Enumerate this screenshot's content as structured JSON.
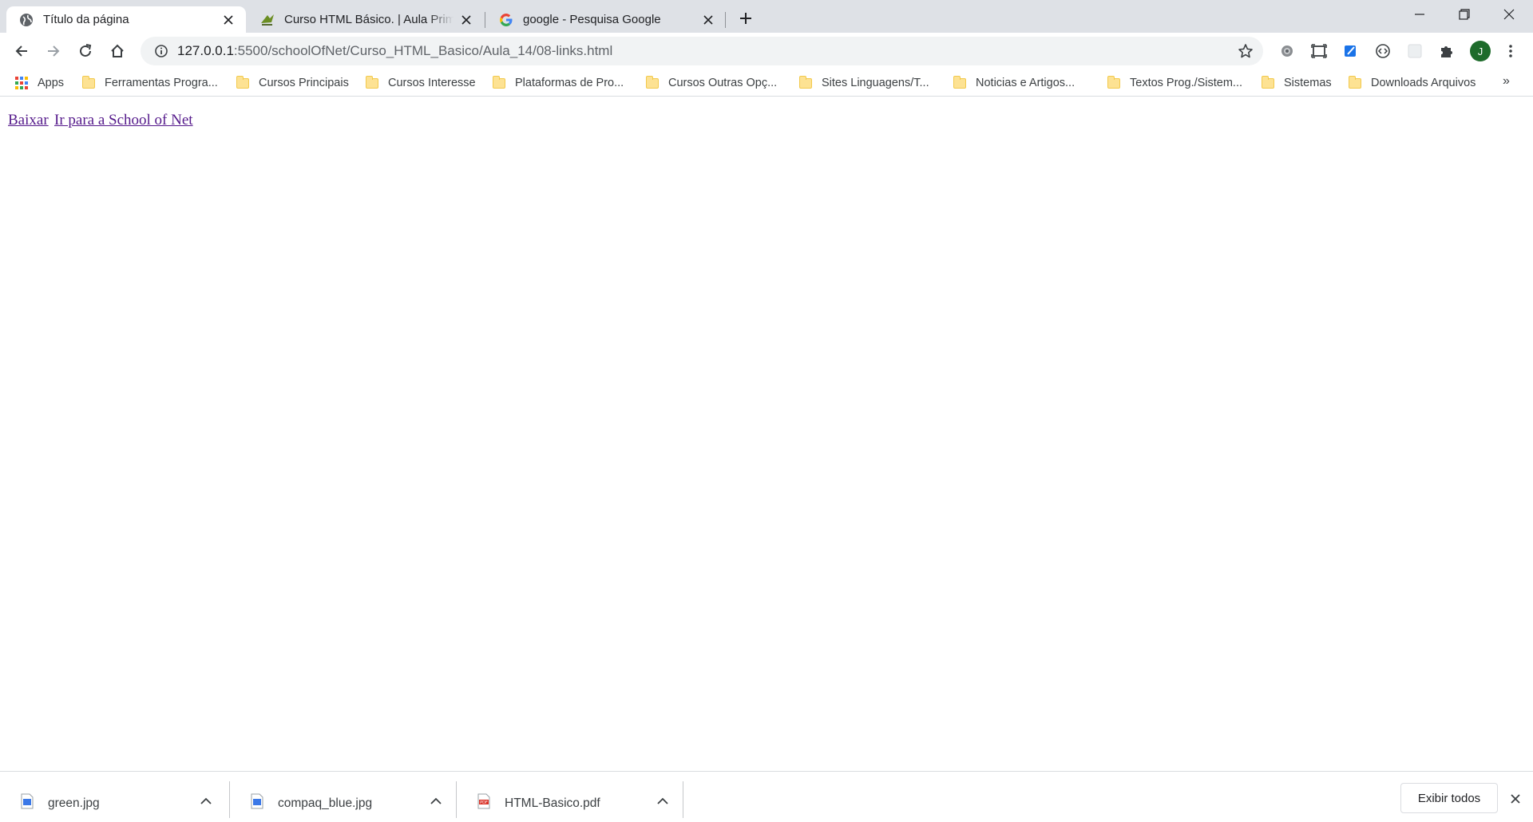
{
  "tabs": [
    {
      "title": "Título da página",
      "favicon": "globe-icon",
      "active": true
    },
    {
      "title": "Curso HTML Básico. | Aula Primeira",
      "favicon": "course-icon",
      "active": false
    },
    {
      "title": "google - Pesquisa Google",
      "favicon": "google-icon",
      "active": false
    }
  ],
  "address_bar": {
    "url_host": "127.0.0.1",
    "url_path": ":5500/schoolOfNet/Curso_HTML_Basico/Aula_14/08-links.html"
  },
  "profile": {
    "initial": "J"
  },
  "bookmarks": {
    "apps_label": "Apps",
    "items": [
      "Ferramentas Progra...",
      "Cursos Principais",
      "Cursos Interesse",
      "Plataformas de Pro...",
      "Cursos Outras Opç...",
      "Sites Linguagens/T...",
      "Noticias e Artigos...",
      "Textos Prog./Sistem...",
      "Sistemas",
      "Downloads Arquivos"
    ],
    "overflow": "»"
  },
  "page": {
    "links": [
      "Baixar",
      "Ir para a School of Net"
    ],
    "link_color": "#551a8b"
  },
  "downloads": {
    "items": [
      {
        "name": "green.jpg",
        "type": "image-file-icon"
      },
      {
        "name": "compaq_blue.jpg",
        "type": "image-file-icon"
      },
      {
        "name": "HTML-Basico.pdf",
        "type": "pdf-file-icon"
      }
    ],
    "show_all_label": "Exibir todos"
  },
  "colors": {
    "tab_strip": "#dee1e6",
    "omnibox": "#f1f3f4",
    "avatar": "#1e6b2b"
  }
}
